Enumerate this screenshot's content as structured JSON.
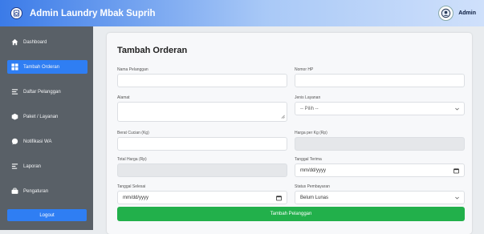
{
  "header": {
    "title": "Admin Laundry Mbak Suprih",
    "admin_label": "Admin"
  },
  "sidebar": {
    "items": [
      {
        "label": "Dashboard",
        "icon": "home-icon",
        "active": false
      },
      {
        "label": "Tambah Orderan",
        "icon": "grid-icon",
        "active": true
      },
      {
        "label": "Daftar Pelanggan",
        "icon": "list-icon",
        "active": false
      },
      {
        "label": "Paket / Layanan",
        "icon": "box-icon",
        "active": false
      },
      {
        "label": "Notifikasi WA",
        "icon": "chat-icon",
        "active": false
      },
      {
        "label": "Laporan",
        "icon": "report-icon",
        "active": false
      },
      {
        "label": "Pengaturan",
        "icon": "gear-icon",
        "active": false
      }
    ],
    "logout_label": "Logout"
  },
  "form": {
    "title": "Tambah Orderan",
    "fields": {
      "nama_pelanggan": {
        "label": "Nama Pelanggan",
        "value": ""
      },
      "nomor_hp": {
        "label": "Nomor HP",
        "value": ""
      },
      "alamat": {
        "label": "Alamat",
        "value": ""
      },
      "jenis_layanan": {
        "label": "Jenis Layanan",
        "value": "-- Pilih --"
      },
      "berat_cucian": {
        "label": "Berat Cucian (Kg)",
        "value": ""
      },
      "harga_per_kg": {
        "label": "Harga per Kg (Rp)",
        "value": ""
      },
      "total_harga": {
        "label": "Total Harga (Rp)",
        "value": ""
      },
      "tanggal_terima": {
        "label": "Tanggal Terima",
        "value": "mm/dd/yyyy"
      },
      "tanggal_selesai": {
        "label": "Tanggal Selesai",
        "value": "mm/dd/yyyy"
      },
      "status_pembayaran": {
        "label": "Status Pembayaran",
        "value": "Belum Lunas"
      }
    },
    "submit_label": "Tambah Pelanggan"
  },
  "colors": {
    "accent": "#2f7ef3",
    "sidebar": "#596067",
    "success": "#22b04b"
  }
}
